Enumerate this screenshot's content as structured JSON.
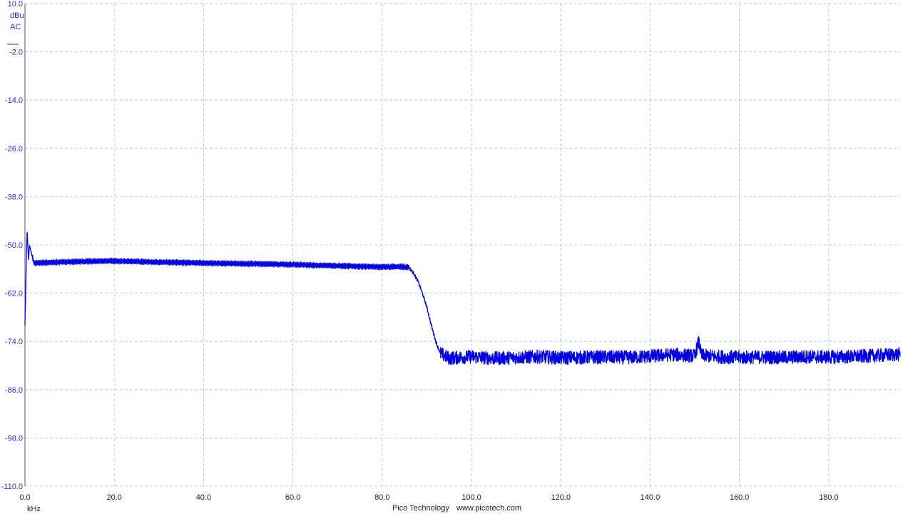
{
  "footer": {
    "brand": "Pico Technology",
    "website": "www.picotech.com"
  },
  "colors": {
    "trace": "#0000e0",
    "axis_text": "#2a2ad0",
    "grid": "#8fc8d8",
    "x_text": "#222222"
  },
  "chart_data": {
    "type": "line",
    "title": "",
    "xlabel": "kHz",
    "ylabel": "dBu",
    "y_unit": "dBu",
    "coupling": "AC",
    "xlim": [
      0,
      196
    ],
    "ylim": [
      -110,
      10
    ],
    "x_ticks": [
      0.0,
      20.0,
      40.0,
      60.0,
      80.0,
      100.0,
      120.0,
      140.0,
      160.0,
      180.0
    ],
    "x_tick_labels": [
      "0.0",
      "20.0",
      "40.0",
      "60.0",
      "80.0",
      "100.0",
      "120.0",
      "140.0",
      "160.0",
      "180.0"
    ],
    "y_ticks": [
      10.0,
      -2.0,
      -14.0,
      -26.0,
      -38.0,
      -50.0,
      -62.0,
      -74.0,
      -86.0,
      -98.0,
      -110.0
    ],
    "y_tick_labels": [
      "10.0",
      "-2.0",
      "-14.0",
      "-26.0",
      "-38.0",
      "-50.0",
      "-62.0",
      "-74.0",
      "-86.0",
      "-98.0",
      "-110.0"
    ],
    "grid": true,
    "legend": "none",
    "series": [
      {
        "color": "#0000e0",
        "x": [
          0.0,
          0.3,
          0.5,
          0.8,
          1.0,
          2.0,
          5.0,
          10.0,
          20.0,
          30.0,
          40.0,
          50.0,
          60.0,
          70.0,
          80.0,
          84.0,
          86.0,
          87.0,
          88.0,
          89.0,
          90.0,
          91.0,
          92.0,
          93.0,
          95.0,
          97.0,
          100.0,
          105.0,
          110.0,
          115.0,
          120.0,
          125.0,
          130.0,
          135.0,
          140.0,
          145.0,
          150.0,
          150.9,
          151.5,
          155.0,
          160.0,
          165.0,
          170.0,
          175.0,
          180.0,
          185.0,
          190.0,
          196.0
        ],
        "y": [
          -70.0,
          -54.0,
          -46.5,
          -54.0,
          -50.0,
          -54.5,
          -54.4,
          -54.2,
          -54.0,
          -54.3,
          -54.5,
          -54.7,
          -54.9,
          -55.2,
          -55.5,
          -55.4,
          -55.6,
          -57.0,
          -59.0,
          -62.0,
          -65.5,
          -70.0,
          -74.0,
          -77.0,
          -78.2,
          -78.0,
          -77.8,
          -78.2,
          -78.0,
          -77.8,
          -78.1,
          -78.0,
          -77.9,
          -78.0,
          -77.7,
          -77.3,
          -77.6,
          -74.0,
          -77.5,
          -77.8,
          -78.0,
          -77.9,
          -78.0,
          -77.8,
          -77.9,
          -77.8,
          -77.6,
          -77.2
        ]
      }
    ]
  }
}
